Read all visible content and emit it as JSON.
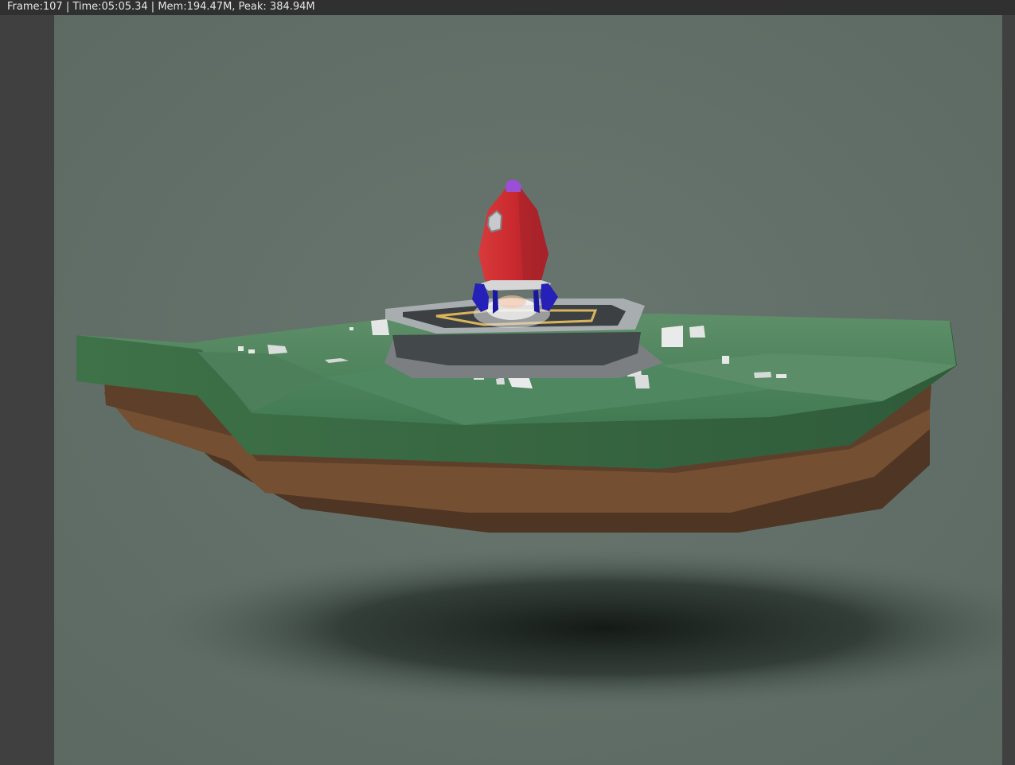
{
  "render_window": {
    "status_text": "Frame:107 | Time:05:05.34 | Mem:194.47M, Peak: 384.94M"
  },
  "scene": {
    "background_color": "#627069",
    "grass_color": "#3f7250",
    "soil_color": "#6b4b32",
    "rocket_color": "#c92a2f",
    "rocket_tip_color": "#9b4fd6",
    "rocket_fin_color": "#2420b8",
    "pad_color": "#a8aeb0",
    "pad_marking_color": "#d9b45c"
  }
}
